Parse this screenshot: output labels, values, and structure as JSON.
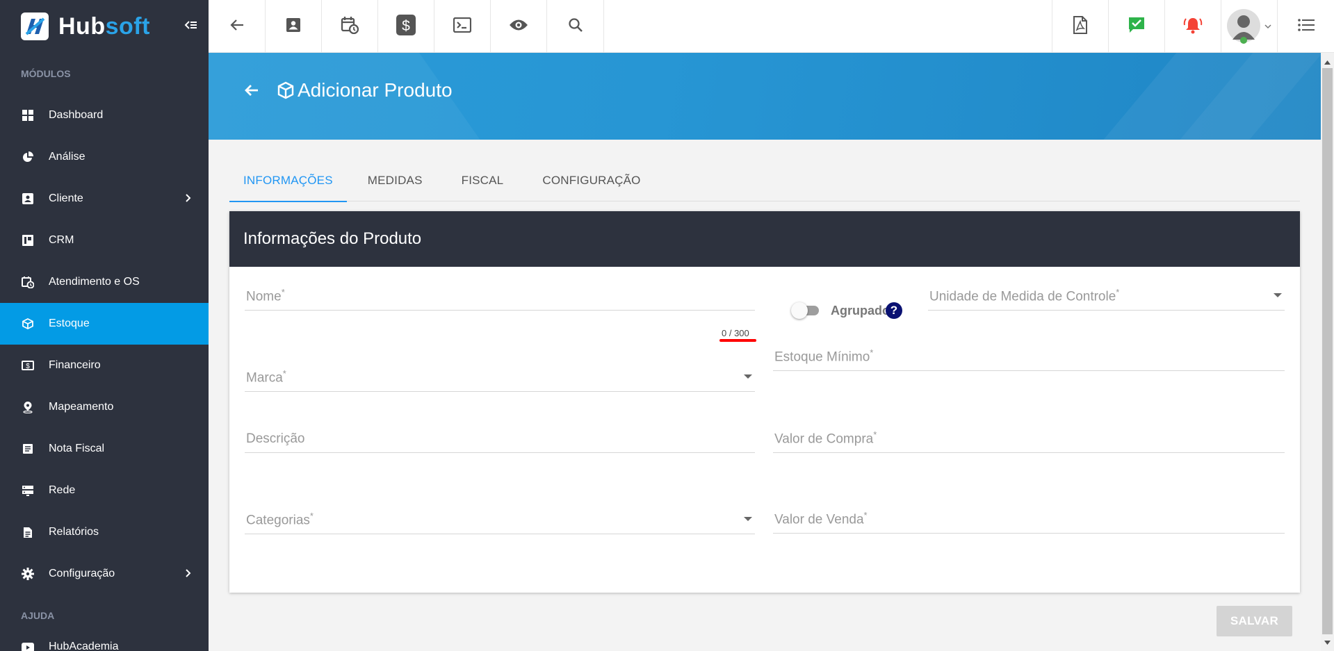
{
  "brand": {
    "name_part1": "Hub",
    "name_part2": "soft"
  },
  "sidebar": {
    "section_modules": "MÓDULOS",
    "items": [
      {
        "label": "Dashboard",
        "icon": "dashboard-icon"
      },
      {
        "label": "Análise",
        "icon": "pie-chart-icon"
      },
      {
        "label": "Cliente",
        "icon": "contact-card-icon",
        "has_submenu": true
      },
      {
        "label": "CRM",
        "icon": "kanban-board-icon"
      },
      {
        "label": "Atendimento e OS",
        "icon": "calendar-clock-icon"
      },
      {
        "label": "Estoque",
        "icon": "cube-icon",
        "active": true
      },
      {
        "label": "Financeiro",
        "icon": "money-icon"
      },
      {
        "label": "Mapeamento",
        "icon": "map-pin-icon"
      },
      {
        "label": "Nota Fiscal",
        "icon": "receipt-icon"
      },
      {
        "label": "Rede",
        "icon": "server-icon"
      },
      {
        "label": "Relatórios",
        "icon": "document-icon"
      },
      {
        "label": "Configuração",
        "icon": "gear-icon",
        "has_submenu": true
      }
    ],
    "section_help": "AJUDA",
    "help_items": [
      {
        "label": "HubAcademia",
        "icon": "play-video-icon"
      }
    ]
  },
  "topbar": {
    "left_icons": [
      "back-arrow-icon",
      "contact-card-icon",
      "calendar-clock-icon",
      "dollar-icon",
      "terminal-icon",
      "eye-icon",
      "search-icon"
    ],
    "right_icons": [
      "pdf-icon",
      "check-message-icon",
      "alarm-bell-icon",
      "user-avatar",
      "list-menu-icon"
    ],
    "colors": {
      "check": "#2eb34a",
      "alarm": "#f44336"
    }
  },
  "header": {
    "title": "Adicionar Produto"
  },
  "tabs": [
    {
      "label": "INFORMAÇÕES",
      "active": true
    },
    {
      "label": "MEDIDAS"
    },
    {
      "label": "FISCAL"
    },
    {
      "label": "CONFIGURAÇÃO"
    }
  ],
  "card": {
    "title": "Informações do Produto",
    "fields": {
      "nome": {
        "label": "Nome",
        "required": "*",
        "value": "",
        "counter": "0 / 300"
      },
      "agrupado": {
        "label": "Agrupado",
        "checked": false,
        "help": "?"
      },
      "unidade": {
        "label": "Unidade de Medida de Controle",
        "required": "*"
      },
      "estoque_minimo": {
        "label": "Estoque Mínimo",
        "required": "*"
      },
      "marca": {
        "label": "Marca",
        "required": "*"
      },
      "descricao": {
        "label": "Descrição"
      },
      "valor_compra": {
        "label": "Valor de Compra",
        "required": "*"
      },
      "categorias": {
        "label": "Categorias",
        "required": "*"
      },
      "valor_venda": {
        "label": "Valor de Venda",
        "required": "*"
      }
    }
  },
  "actions": {
    "save": "SALVAR"
  },
  "colors": {
    "primary": "#039be5",
    "sidebar": "#2d323e",
    "accent_tab": "#2196f3",
    "highlight": "#ff0000"
  }
}
